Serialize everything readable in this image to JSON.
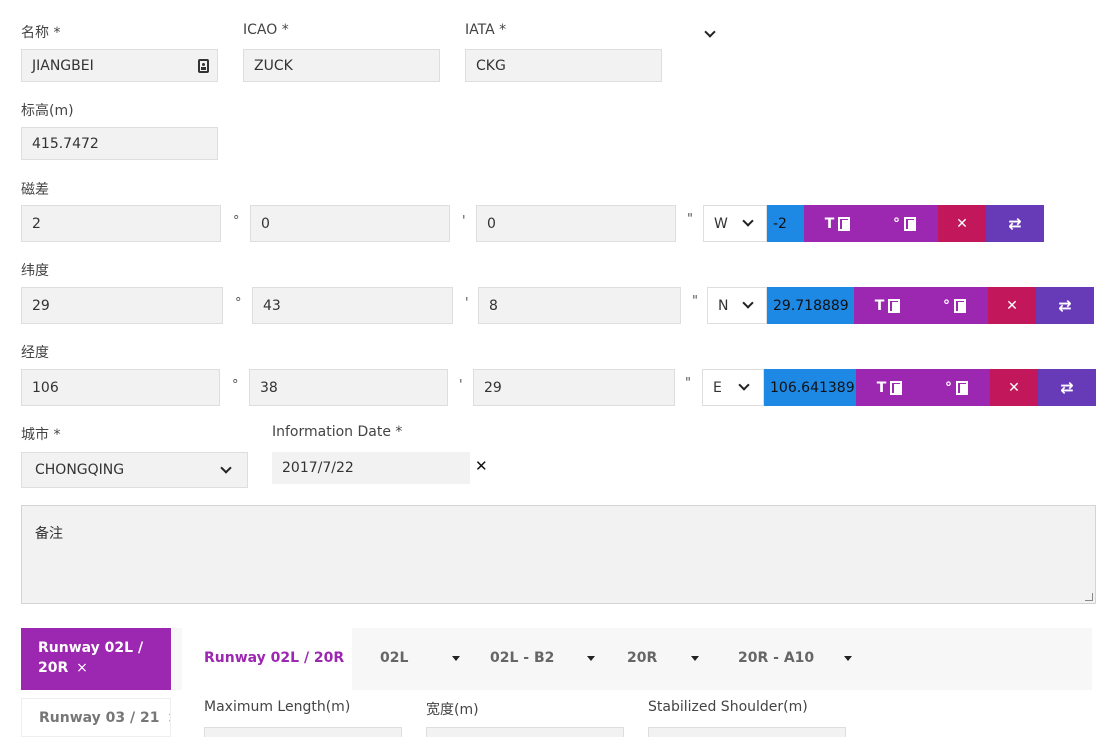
{
  "airport": {
    "name_label": "名称 *",
    "name_value": "JIANGBEI",
    "icao_label": "ICAO *",
    "icao_value": "ZUCK",
    "iata_label": "IATA *",
    "iata_value": "CKG",
    "elevation_label": "标高(m)",
    "elevation_value": "415.7472"
  },
  "magvar": {
    "label": "磁差",
    "deg": "2",
    "min": "0",
    "sec": "0",
    "dir": "W",
    "decimal": "-2"
  },
  "latitude": {
    "label": "纬度",
    "deg": "29",
    "min": "43",
    "sec": "8",
    "dir": "N",
    "decimal": "29.718889"
  },
  "longitude": {
    "label": "经度",
    "deg": "106",
    "min": "38",
    "sec": "29",
    "dir": "E",
    "decimal": "106.641389"
  },
  "symbols": {
    "deg": "°",
    "min": "'",
    "sec": "\"",
    "btn_t": "T",
    "btn_deg": "°",
    "btn_clear": "✕",
    "btn_swap": "⇄",
    "close": "✕",
    "small_close": "×"
  },
  "city": {
    "label": "城市 *",
    "value": "CHONGQING"
  },
  "info_date": {
    "label": "Information Date *",
    "value": "2017/7/22"
  },
  "remarks": {
    "placeholder": "备注"
  },
  "runways": {
    "side_tabs": [
      {
        "label": "Runway 02L / 20R"
      },
      {
        "label": "Runway 03 / 21"
      }
    ],
    "top_tabs": [
      {
        "label": "Runway 02L / 20R"
      },
      {
        "label": "02L"
      },
      {
        "label": "02L - B2"
      },
      {
        "label": "20R"
      },
      {
        "label": "20R - A10"
      }
    ],
    "fields": {
      "max_length": "Maximum Length(m)",
      "width": "宽度(m)",
      "shoulder": "Stabilized Shoulder(m)"
    }
  },
  "colors": {
    "purple": "#9c27b0",
    "magenta": "#c2185b",
    "violet": "#673ab7",
    "blue": "#1e88e5"
  }
}
